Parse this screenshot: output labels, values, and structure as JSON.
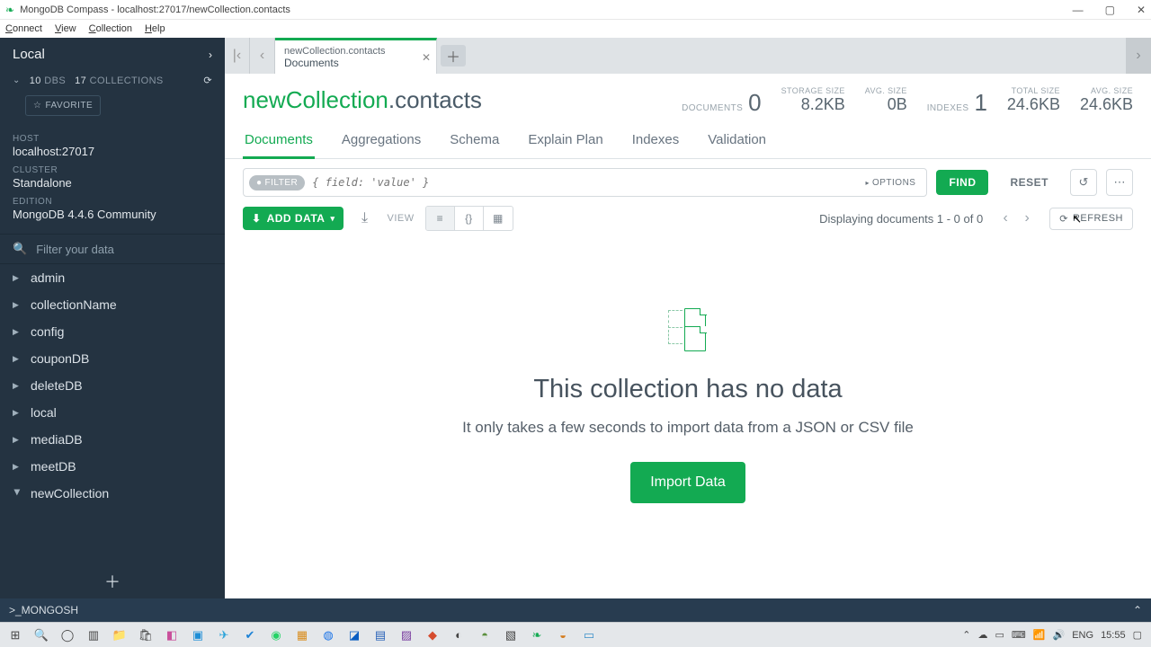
{
  "window": {
    "title": "MongoDB Compass - localhost:27017/newCollection.contacts"
  },
  "menubar": [
    "Connect",
    "View",
    "Collection",
    "Help"
  ],
  "sidebar": {
    "connLabel": "Local",
    "dbCount": "10",
    "dbLabel": "DBS",
    "colCount": "17",
    "colLabel": "COLLECTIONS",
    "favorite": "FAVORITE",
    "hostLabel": "HOST",
    "host": "localhost:27017",
    "clusterLabel": "CLUSTER",
    "cluster": "Standalone",
    "editionLabel": "EDITION",
    "edition": "MongoDB 4.4.6 Community",
    "filterPlaceholder": "Filter your data",
    "items": [
      {
        "name": "admin"
      },
      {
        "name": "collectionName"
      },
      {
        "name": "config"
      },
      {
        "name": "couponDB"
      },
      {
        "name": "deleteDB"
      },
      {
        "name": "local"
      },
      {
        "name": "mediaDB"
      },
      {
        "name": "meetDB"
      },
      {
        "name": "newCollection",
        "expanded": true
      }
    ]
  },
  "tab": {
    "path": "newCollection.contacts",
    "sub": "Documents"
  },
  "title": {
    "db": "newCollection",
    "col": ".contacts"
  },
  "stats": {
    "documentsLabel": "DOCUMENTS",
    "documents": "0",
    "storageLabel": "STORAGE SIZE",
    "storage": "8.2KB",
    "avgLabel": "AVG. SIZE",
    "avg": "0B",
    "indexesLabel": "INDEXES",
    "indexes": "1",
    "totalLabel": "TOTAL SIZE",
    "total": "24.6KB",
    "avg2Label": "AVG. SIZE",
    "avg2": "24.6KB"
  },
  "tabs": [
    "Documents",
    "Aggregations",
    "Schema",
    "Explain Plan",
    "Indexes",
    "Validation"
  ],
  "filter": {
    "pill": "FILTER",
    "placeholder": "{ field: 'value' }",
    "options": "OPTIONS",
    "find": "FIND",
    "reset": "RESET"
  },
  "toolbar": {
    "addData": "ADD DATA",
    "viewLabel": "VIEW",
    "displaying": "Displaying documents 1 - 0 of 0",
    "refresh": "REFRESH"
  },
  "empty": {
    "heading": "This collection has no data",
    "sub": "It only takes a few seconds to import data from a JSON or CSV file",
    "button": "Import Data"
  },
  "footer": {
    "shell": ">_MONGOSH"
  },
  "tray": {
    "lang": "ENG",
    "time": "15:55"
  }
}
